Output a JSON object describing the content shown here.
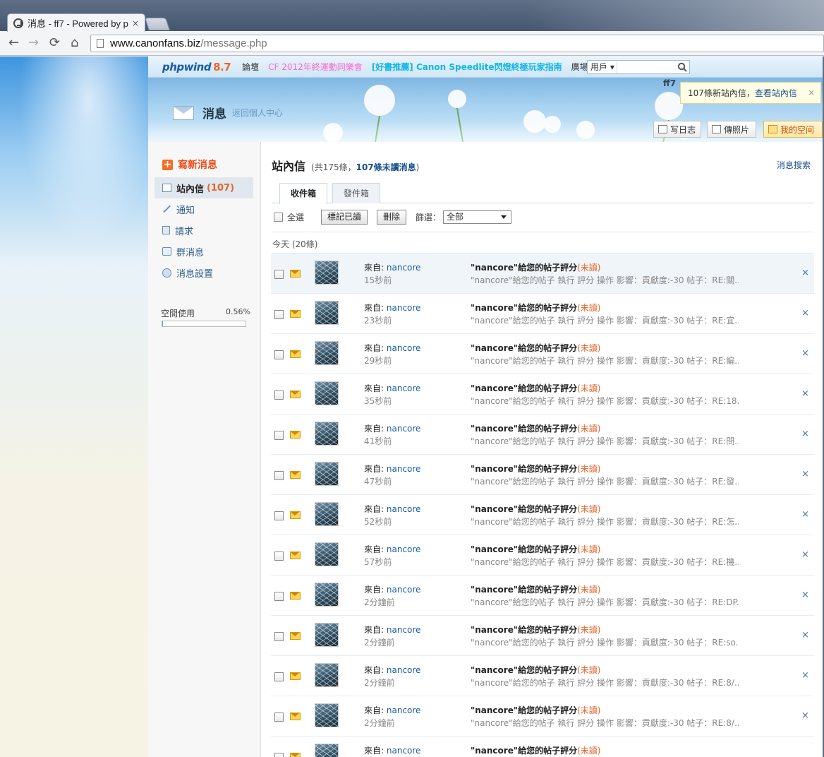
{
  "browser": {
    "tab_title": "消息 - ff7 - Powered by p",
    "tab_close": "×",
    "url_domain": "www.canonfans.biz",
    "url_path": "/message.php",
    "nav_back": "←",
    "nav_forward": "→",
    "nav_reload": "⟳",
    "nav_home": "⌂"
  },
  "site": {
    "logo_text": "phpwind",
    "logo_version": "8.7",
    "nav": {
      "forum": "論壇",
      "event": "CF 2012年終運動同樂會",
      "recommend": "[好書推薦] Canon Speedlite閃燈終極玩家指南",
      "plaza": "廣場"
    },
    "search_scope": "用戶 ▾",
    "search_placeholder": "",
    "user": "ff7"
  },
  "notice": {
    "count_text": "107條新站內信，",
    "link_text": "查看站內信",
    "close": "×"
  },
  "header": {
    "title": "消息",
    "back_link": "返回個人中心"
  },
  "quick_buttons": {
    "diary": "写日志",
    "photo": "傳照片",
    "space": "我的空间"
  },
  "sidebar": {
    "compose_label": "寫新消息",
    "compose_icon": "+",
    "items": [
      {
        "label": "站內信",
        "count": "(107)"
      },
      {
        "label": "通知"
      },
      {
        "label": "請求"
      },
      {
        "label": "群消息"
      },
      {
        "label": "消息設置"
      }
    ],
    "space_label": "空間使用",
    "space_percent": "0.56%",
    "space_fraction": 0.0056
  },
  "content": {
    "title": "站內信",
    "summary_prefix": "(共175條，",
    "summary_unread": "107條未讀消息",
    "summary_suffix": ")",
    "search_link": "消息搜索",
    "tabs": [
      "收件箱",
      "發件箱"
    ],
    "select_all": "全選",
    "mark_read": "標記已讀",
    "delete": "刪除",
    "filter_label": "篩選：",
    "filter_value": "全部",
    "group_label": "今天 (20條)"
  },
  "messages": [
    {
      "from_label": "來自:",
      "from": "nancore",
      "time": "15秒前",
      "subject": "\"nancore\"給您的帖子評分",
      "unread": "(未讀)",
      "preview": "\"nancore\"給您的帖子 執行 評分 操作 影響：貢獻度:-30 帖子：RE:關...",
      "close": "×"
    },
    {
      "from_label": "來自:",
      "from": "nancore",
      "time": "23秒前",
      "subject": "\"nancore\"給您的帖子評分",
      "unread": "(未讀)",
      "preview": "\"nancore\"給您的帖子 執行 評分 操作 影響：貢獻度:-30 帖子：RE:宜...",
      "close": "×"
    },
    {
      "from_label": "來自:",
      "from": "nancore",
      "time": "29秒前",
      "subject": "\"nancore\"給您的帖子評分",
      "unread": "(未讀)",
      "preview": "\"nancore\"給您的帖子 執行 評分 操作 影響：貢獻度:-30 帖子：RE:編...",
      "close": "×"
    },
    {
      "from_label": "來自:",
      "from": "nancore",
      "time": "35秒前",
      "subject": "\"nancore\"給您的帖子評分",
      "unread": "(未讀)",
      "preview": "\"nancore\"給您的帖子 執行 評分 操作 影響：貢獻度:-30 帖子：RE:18...",
      "close": "×"
    },
    {
      "from_label": "來自:",
      "from": "nancore",
      "time": "41秒前",
      "subject": "\"nancore\"給您的帖子評分",
      "unread": "(未讀)",
      "preview": "\"nancore\"給您的帖子 執行 評分 操作 影響：貢獻度:-30 帖子：RE:問...",
      "close": "×"
    },
    {
      "from_label": "來自:",
      "from": "nancore",
      "time": "47秒前",
      "subject": "\"nancore\"給您的帖子評分",
      "unread": "(未讀)",
      "preview": "\"nancore\"給您的帖子 執行 評分 操作 影響：貢獻度:-30 帖子：RE:發...",
      "close": "×"
    },
    {
      "from_label": "來自:",
      "from": "nancore",
      "time": "52秒前",
      "subject": "\"nancore\"給您的帖子評分",
      "unread": "(未讀)",
      "preview": "\"nancore\"給您的帖子 執行 評分 操作 影響：貢獻度:-30 帖子：RE:怎...",
      "close": "×"
    },
    {
      "from_label": "來自:",
      "from": "nancore",
      "time": "57秒前",
      "subject": "\"nancore\"給您的帖子評分",
      "unread": "(未讀)",
      "preview": "\"nancore\"給您的帖子 執行 評分 操作 影響：貢獻度:-30 帖子：RE:機...",
      "close": "×"
    },
    {
      "from_label": "來自:",
      "from": "nancore",
      "time": "2分鐘前",
      "subject": "\"nancore\"給您的帖子評分",
      "unread": "(未讀)",
      "preview": "\"nancore\"給您的帖子 執行 評分 操作 影響：貢獻度:-30 帖子：RE:DP...",
      "close": "×"
    },
    {
      "from_label": "來自:",
      "from": "nancore",
      "time": "2分鐘前",
      "subject": "\"nancore\"給您的帖子評分",
      "unread": "(未讀)",
      "preview": "\"nancore\"給您的帖子 執行 評分 操作 影響：貢獻度:-30 帖子：RE:so...",
      "close": "×"
    },
    {
      "from_label": "來自:",
      "from": "nancore",
      "time": "2分鐘前",
      "subject": "\"nancore\"給您的帖子評分",
      "unread": "(未讀)",
      "preview": "\"nancore\"給您的帖子 執行 評分 操作 影響：貢獻度:-30 帖子：RE:8/...",
      "close": "×"
    },
    {
      "from_label": "來自:",
      "from": "nancore",
      "time": "2分鐘前",
      "subject": "\"nancore\"給您的帖子評分",
      "unread": "(未讀)",
      "preview": "\"nancore\"給您的帖子 執行 評分 操作 影響：貢獻度:-30 帖子：RE:8/...",
      "close": "×"
    },
    {
      "from_label": "來自:",
      "from": "nancore",
      "time": "",
      "subject": "\"nancore\"給您的帖子評分",
      "unread": "(未讀)",
      "preview": "",
      "close": ""
    }
  ],
  "colors": {
    "accent_orange": "#f04c17",
    "link_blue": "#1a5ea0",
    "unread_orange": "#e4642a",
    "nav_pink": "#ff66cc",
    "nav_cyan": "#12b7e6"
  }
}
